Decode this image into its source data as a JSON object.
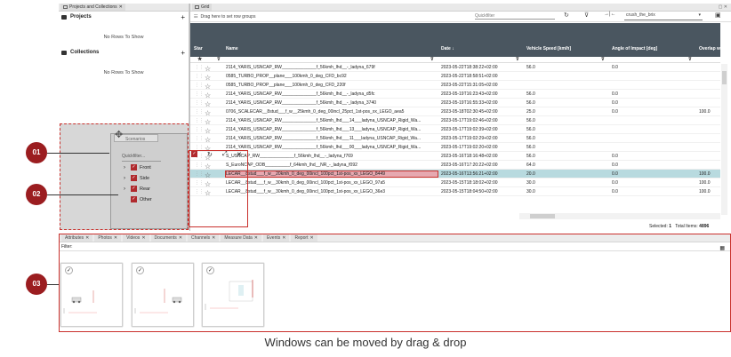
{
  "left_panel": {
    "tab_label": "Projects and Collections",
    "projects_title": "Projects",
    "collections_title": "Collections",
    "no_rows": "No Rows To Show"
  },
  "scenarios": {
    "title": "Scenarios",
    "quickfilter_placeholder": "Quickfilter...",
    "items": [
      {
        "label": "Front",
        "checked": true,
        "expandable": true
      },
      {
        "label": "Side",
        "checked": true,
        "expandable": true
      },
      {
        "label": "Rear",
        "checked": true,
        "expandable": true
      },
      {
        "label": "Other",
        "checked": true,
        "expandable": false
      }
    ]
  },
  "grid": {
    "tab_label": "Grid",
    "group_hint": "Drag here to set row groups",
    "quickfilter_placeholder": "Quickfilter",
    "view_select": "crush_the_brix",
    "columns": {
      "star": "Star",
      "name": "Name",
      "date": "Date",
      "speed": "Vehicle Speed [km/h]",
      "angle": "Angle of Impact [deg]",
      "overlap": "Overlap with E"
    },
    "rows": [
      {
        "name": "2114_YARIS_USNCAP_RW______________f_56kmh_lhd__-_ladyna_679f",
        "date": "2023-05-22T18:38:22+02:00",
        "speed": "56.0",
        "angle": "0.0",
        "overlap": ""
      },
      {
        "name": "0585_TURBO_PROP__plane___100kmh_0_deg_CFD_bc92",
        "date": "2023-05-22T18:58:51+02:00",
        "speed": "",
        "angle": "",
        "overlap": ""
      },
      {
        "name": "0585_TURBO_PROP__plane___100kmh_0_deg_CFD_220f",
        "date": "2023-05-22T15:31:05+02:00",
        "speed": "",
        "angle": "",
        "overlap": ""
      },
      {
        "name": "2114_YARIS_USNCAP_RW______________f_56kmh_lhd__-_ladyna_d5fc",
        "date": "2023-05-19T16:23:43+02:00",
        "speed": "56.0",
        "angle": "0.0",
        "overlap": ""
      },
      {
        "name": "2114_YARIS_USNCAP_RW______________f_56kmh_lhd__-_ladyna_3740",
        "date": "2023-05-19T16:55:33+02:00",
        "speed": "56.0",
        "angle": "0.0",
        "overlap": ""
      },
      {
        "name": "0706_SCALECAR__8stud___f_w__25kmh_0_deg_00incl_25pct_1st-pos_xx_LEGO_aea5",
        "date": "2023-05-18T02:30:45+02:00",
        "speed": "25.0",
        "angle": "0.0",
        "overlap": "100.0"
      },
      {
        "name": "2114_YARIS_USNCAP_RW______________f_56kmh_lhd___14___ladyna_USNCAP_Rigid_Wa...",
        "date": "2023-05-17T19:02:46+02:00",
        "speed": "56.0",
        "angle": "",
        "overlap": ""
      },
      {
        "name": "2114_YARIS_USNCAP_RW______________f_56kmh_lhd___13___ladyna_USNCAP_Rigid_Wa...",
        "date": "2023-05-17T19:02:39+02:00",
        "speed": "56.0",
        "angle": "",
        "overlap": ""
      },
      {
        "name": "2114_YARIS_USNCAP_RW______________f_56kmh_lhd___11___ladyna_USNCAP_Rigid_Wa...",
        "date": "2023-05-17T19:02:29+02:00",
        "speed": "56.0",
        "angle": "",
        "overlap": ""
      },
      {
        "name": "2114_YARIS_USNCAP_RW______________f_56kmh_lhd___00___ladyna_USNCAP_Rigid_Wa...",
        "date": "2023-05-17T19:02:20+02:00",
        "speed": "56.0",
        "angle": "",
        "overlap": ""
      },
      {
        "name": "S_USNCAP_RW______________f_56kmh_lhd__-_ladyna_f769",
        "date": "2023-05-16T18:16:48+02:00",
        "speed": "56.0",
        "angle": "0.0",
        "overlap": ""
      },
      {
        "name": "S_EuroNCAP_ODB__________f_64kmh_lhd__NR_-_ladyna_f092",
        "date": "2023-05-16T17:20:22+02:00",
        "speed": "64.0",
        "angle": "0.0",
        "overlap": ""
      },
      {
        "name": "LECAR__8stud___f_w__20kmh_0_deg_00incl_100pct_1st-pos_xx_LEGO_8449",
        "date": "2023-05-16T13:56:21+02:00",
        "speed": "20.0",
        "angle": "0.0",
        "overlap": "100.0"
      },
      {
        "name": "LECAR__8stud___f_w__30kmh_0_deg_00incl_100pct_1st-pos_xx_LEGO_97a5",
        "date": "2023-05-15T18:18:02+02:00",
        "speed": "30.0",
        "angle": "0.0",
        "overlap": "100.0"
      },
      {
        "name": "LECAR__8stud___f_w__30kmh_0_deg_00incl_100pct_1st-pos_xx_LEGO_36e3",
        "date": "2023-05-15T18:04:50+02:00",
        "speed": "30.0",
        "angle": "0.0",
        "overlap": "100.0"
      }
    ],
    "selected_label": "Selected:",
    "selected_count": "1",
    "total_label": "Total Items:",
    "total_count": "4896"
  },
  "bottom": {
    "tabs": [
      "Attributes",
      "Photos",
      "Videos",
      "Documents",
      "Channels",
      "Measure Data",
      "Events",
      "Report"
    ],
    "filter_label": "Filter:"
  },
  "callouts": [
    "01",
    "02",
    "03"
  ],
  "caption": "Windows can be moved by drag & drop",
  "colors": {
    "accent_red": "#c9302c",
    "badge": "#9b1d20",
    "header": "#4a5660",
    "selected_row": "#b8dadf"
  }
}
